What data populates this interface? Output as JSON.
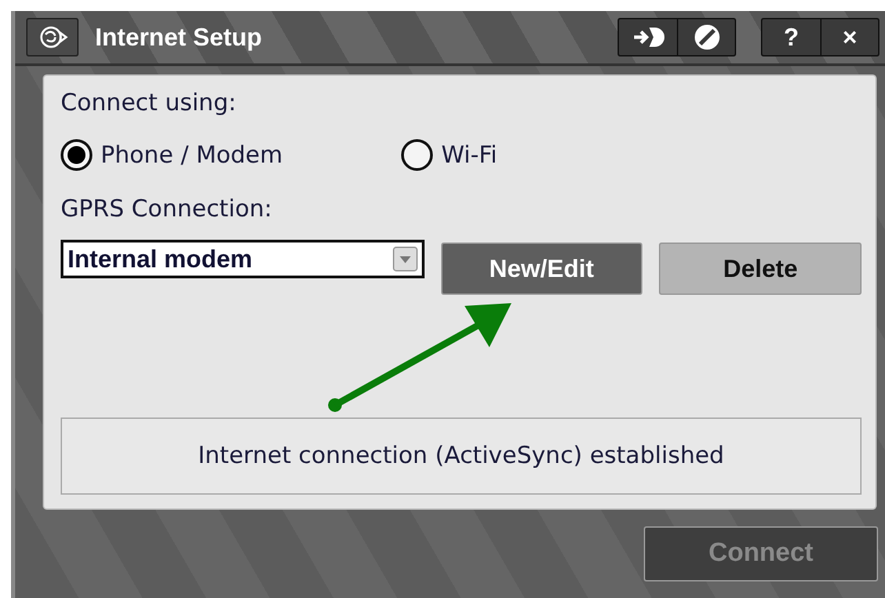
{
  "window": {
    "title": "Internet Setup",
    "help_button": "?",
    "close_button": "×"
  },
  "connect_using": {
    "label": "Connect using:",
    "options": [
      {
        "label": "Phone / Modem",
        "selected": true
      },
      {
        "label": "Wi-Fi",
        "selected": false
      }
    ]
  },
  "gprs": {
    "label": "GPRS Connection:",
    "value": "Internal modem"
  },
  "buttons": [
    {
      "label": "New/Edit",
      "kind": "dark"
    },
    {
      "label": "Delete",
      "kind": "light"
    }
  ],
  "status": "Internet connection (ActiveSync) established",
  "connect_button": {
    "label": "Connect",
    "disabled": true
  }
}
